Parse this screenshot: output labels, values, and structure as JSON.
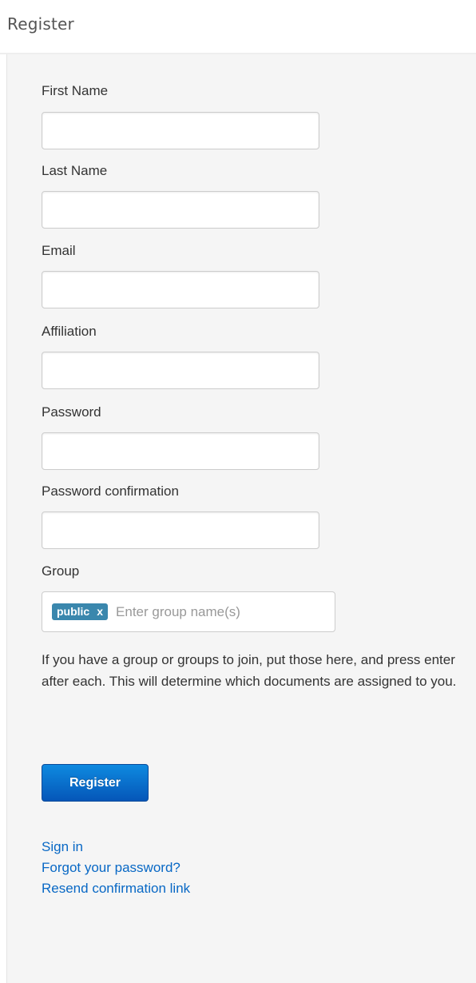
{
  "page": {
    "title": "Register"
  },
  "form": {
    "fields": [
      {
        "label": "First Name",
        "value": "",
        "type": "text"
      },
      {
        "label": "Last Name",
        "value": "",
        "type": "text"
      },
      {
        "label": "Email",
        "value": "",
        "type": "email"
      },
      {
        "label": "Affiliation",
        "value": "",
        "type": "text"
      },
      {
        "label": "Password",
        "value": "",
        "type": "password"
      },
      {
        "label": "Password confirmation",
        "value": "",
        "type": "password"
      }
    ],
    "group": {
      "label": "Group",
      "tags": [
        {
          "text": "public",
          "remove_label": "x"
        }
      ],
      "placeholder": "Enter group name(s)",
      "help_text": "If you have a group or groups to join, put those here, and press enter after each. This will determine which documents are assigned to you."
    },
    "submit_label": "Register"
  },
  "links": {
    "sign_in": "Sign in",
    "forgot_password": "Forgot your password?",
    "resend_confirmation": "Resend confirmation link"
  },
  "colors": {
    "tag_background": "#3a87ad",
    "button_primary": "#0e6fd1",
    "link": "#0868c5",
    "panel_background": "#f5f5f5"
  }
}
